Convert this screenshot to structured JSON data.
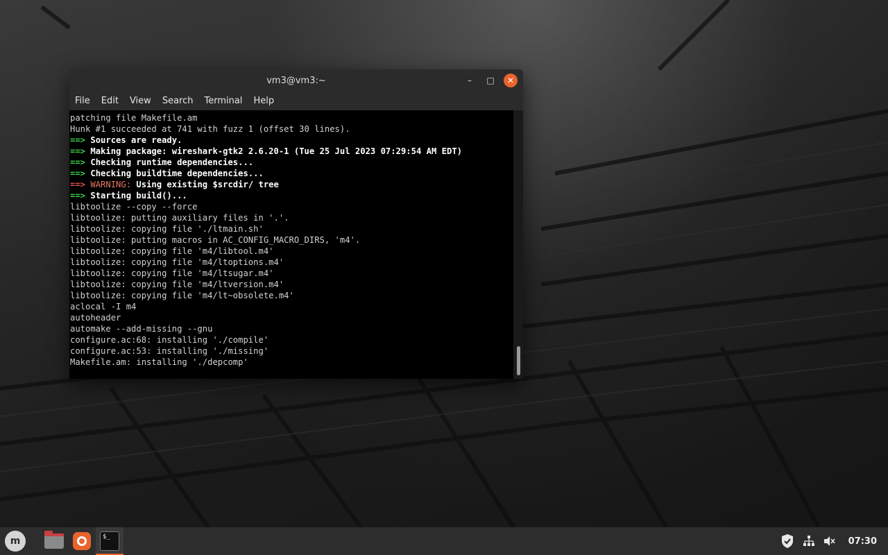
{
  "window": {
    "title": "vm3@vm3:~",
    "minimize_glyph": "–",
    "maximize_glyph": "□",
    "close_glyph": "✕"
  },
  "menu": [
    "File",
    "Edit",
    "View",
    "Search",
    "Terminal",
    "Help"
  ],
  "terminal": {
    "lines": [
      {
        "type": "plain",
        "text": "patching file Makefile.am"
      },
      {
        "type": "plain",
        "text": "Hunk #1 succeeded at 741 with fuzz 1 (offset 30 lines)."
      },
      {
        "type": "green",
        "arrow": "==>",
        "text": " Sources are ready."
      },
      {
        "type": "green",
        "arrow": "==>",
        "text": " Making package: wireshark-gtk2 2.6.20-1 (Tue 25 Jul 2023 07:29:54 AM EDT)"
      },
      {
        "type": "green",
        "arrow": "==>",
        "text": " Checking runtime dependencies..."
      },
      {
        "type": "green",
        "arrow": "==>",
        "text": " Checking buildtime dependencies..."
      },
      {
        "type": "warning",
        "arrow": "==>",
        "warn": " WARNING:",
        "text": " Using existing $srcdir/ tree"
      },
      {
        "type": "green",
        "arrow": "==>",
        "text": " Starting build()..."
      },
      {
        "type": "plain",
        "text": "libtoolize --copy --force"
      },
      {
        "type": "plain",
        "text": "libtoolize: putting auxiliary files in '.'."
      },
      {
        "type": "plain",
        "text": "libtoolize: copying file './ltmain.sh'"
      },
      {
        "type": "plain",
        "text": "libtoolize: putting macros in AC_CONFIG_MACRO_DIRS, 'm4'."
      },
      {
        "type": "plain",
        "text": "libtoolize: copying file 'm4/libtool.m4'"
      },
      {
        "type": "plain",
        "text": "libtoolize: copying file 'm4/ltoptions.m4'"
      },
      {
        "type": "plain",
        "text": "libtoolize: copying file 'm4/ltsugar.m4'"
      },
      {
        "type": "plain",
        "text": "libtoolize: copying file 'm4/ltversion.m4'"
      },
      {
        "type": "plain",
        "text": "libtoolize: copying file 'm4/lt~obsolete.m4'"
      },
      {
        "type": "plain",
        "text": "aclocal -I m4"
      },
      {
        "type": "plain",
        "text": "autoheader"
      },
      {
        "type": "plain",
        "text": "automake --add-missing --gnu"
      },
      {
        "type": "plain",
        "text": "configure.ac:68: installing './compile'"
      },
      {
        "type": "plain",
        "text": "configure.ac:53: installing './missing'"
      },
      {
        "type": "plain",
        "text": "Makefile.am: installing './depcomp'"
      }
    ]
  },
  "taskbar": {
    "menu_logo_letter": "m",
    "terminal_icon_text": "$_",
    "clock": "07:30"
  },
  "colors": {
    "accent": "#e9642d",
    "arrow_green": "#3ecf4d",
    "arrow_red": "#e0514e",
    "warning": "#e5765d"
  }
}
